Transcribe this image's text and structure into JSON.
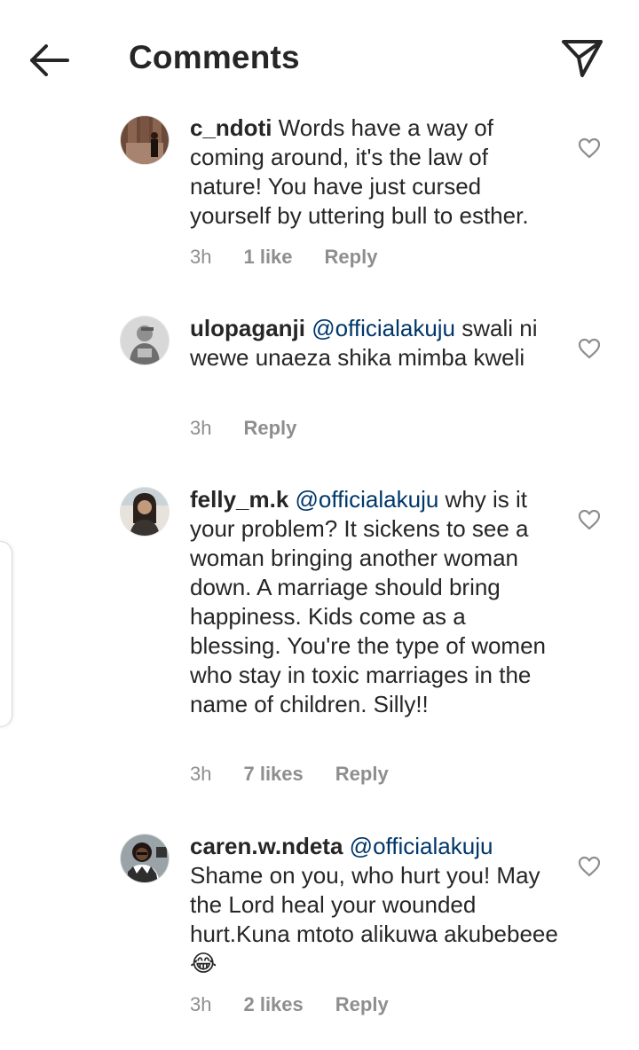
{
  "header": {
    "title": "Comments",
    "back_icon": "arrow-left-icon",
    "send_icon": "paper-plane-icon"
  },
  "colors": {
    "text": "#262626",
    "mention": "#00376b",
    "meta": "#8e8e8e"
  },
  "comments": [
    {
      "username": "c_ndoti",
      "text": " Words have a way of coming around, it's the law of nature! You have just cursed yourself by uttering bull to esther.",
      "time": "3h",
      "likes": "1 like",
      "reply": "Reply"
    },
    {
      "username": "ulopaganji",
      "mention": "@officialakuju",
      "text": " swali ni wewe unaeza shika mimba kweli",
      "time": "3h",
      "reply": "Reply"
    },
    {
      "username": "felly_m.k",
      "mention": "@officialakuju",
      "text": " why is it your problem? It sickens to see a woman bringing another woman down. A marriage should bring happiness. Kids come as a blessing. You're the type of women who stay in toxic marriages in the name of children. Silly!!",
      "time": "3h",
      "likes": "7 likes",
      "reply": "Reply"
    },
    {
      "username": "caren.w.ndeta",
      "mention": "@officialakuju",
      "text": " Shame on you, who hurt you! May the Lord heal your wounded hurt.Kuna mtoto alikuwa akubebeee😂",
      "time": "3h",
      "likes": "2 likes",
      "reply": "Reply"
    }
  ]
}
